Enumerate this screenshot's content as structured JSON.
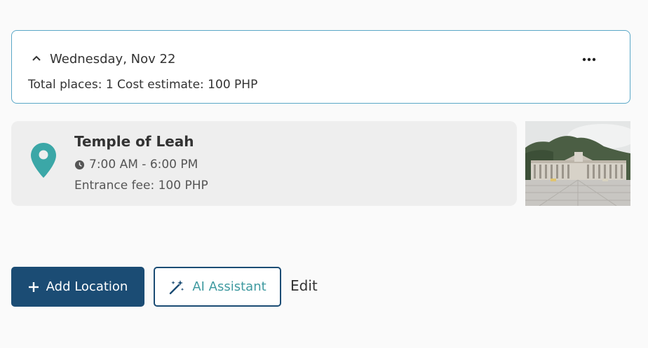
{
  "day": {
    "title": "Wednesday, Nov 22",
    "summary": "Total places: 1 Cost estimate: 100 PHP"
  },
  "place": {
    "name": "Temple of Leah",
    "hours": "7:00 AM - 6:00 PM",
    "fee": "Entrance fee: 100 PHP"
  },
  "actions": {
    "add_location": "Add Location",
    "ai_assistant": "AI Assistant",
    "edit": "Edit"
  },
  "colors": {
    "primary": "#1b4c74",
    "accent_teal": "#3f9aa0",
    "card_border": "#5aa7c7"
  }
}
